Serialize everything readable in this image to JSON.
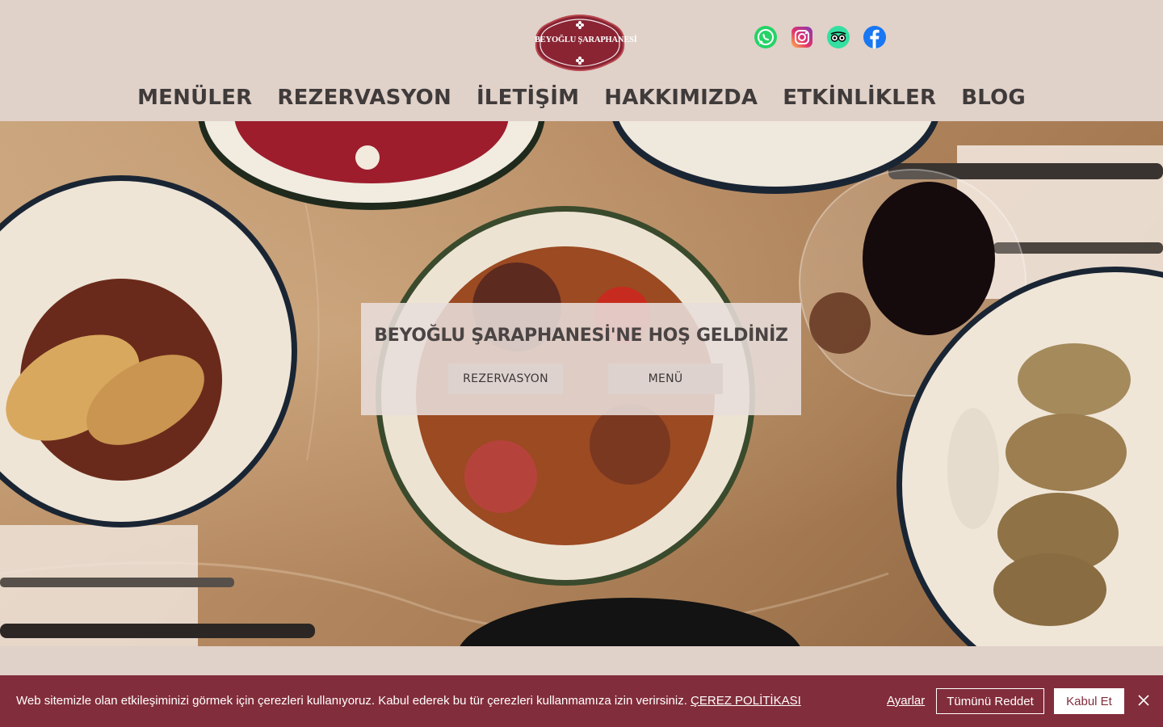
{
  "header": {
    "logo_text": "BEYOĞLU ŞARAPHANESİ",
    "socials": [
      {
        "name": "whatsapp",
        "icon": "whatsapp-icon",
        "color": "#25d366"
      },
      {
        "name": "instagram",
        "icon": "instagram-icon",
        "color": "#e1306c"
      },
      {
        "name": "tripadvisor",
        "icon": "tripadvisor-icon",
        "color": "#34e0a1"
      },
      {
        "name": "facebook",
        "icon": "facebook-icon",
        "color": "#1877f2"
      }
    ]
  },
  "nav": {
    "items": [
      "MENÜLER",
      "REZERVASYON",
      "İLETİŞİM",
      "HAKKIMIZDA",
      "ETKİNLİKLER",
      "BLOG"
    ]
  },
  "hero": {
    "title": "BEYOĞLU ŞARAPHANESİ'NE HOŞ GELDİNİZ",
    "reservation_button": "REZERVASYON",
    "menu_button": "MENÜ"
  },
  "cookie": {
    "text": "Web sitemizle olan etkileşiminizi görmek için çerezleri kullanıyoruz. Kabul ederek bu tür çerezleri kullanmamıza izin verirsiniz.",
    "policy_link": "ÇEREZ POLİTİKASI",
    "settings_label": "Ayarlar",
    "reject_label": "Tümünü Reddet",
    "accept_label": "Kabul Et",
    "background_color": "#822d3b"
  }
}
